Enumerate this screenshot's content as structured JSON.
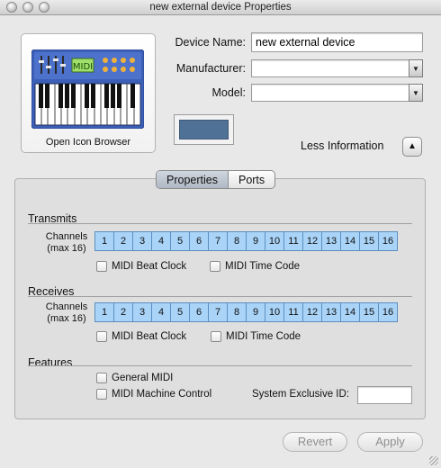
{
  "window": {
    "title": "new external device Properties"
  },
  "icon": {
    "caption": "Open Icon Browser",
    "display_text": "MIDI"
  },
  "form": {
    "device_name_label": "Device Name:",
    "device_name_value": "new external device",
    "manufacturer_label": "Manufacturer:",
    "manufacturer_value": "",
    "model_label": "Model:",
    "model_value": "",
    "color": "#4f7196"
  },
  "disclosure": {
    "label": "Less Information"
  },
  "tabs": [
    {
      "label": "Properties",
      "selected": true
    },
    {
      "label": "Ports",
      "selected": false
    }
  ],
  "transmits": {
    "title": "Transmits",
    "channels_label_line1": "Channels",
    "channels_label_line2": "(max 16)",
    "channels": [
      "1",
      "2",
      "3",
      "4",
      "5",
      "6",
      "7",
      "8",
      "9",
      "10",
      "11",
      "12",
      "13",
      "14",
      "15",
      "16"
    ],
    "beat_clock_label": "MIDI Beat Clock",
    "time_code_label": "MIDI Time Code"
  },
  "receives": {
    "title": "Receives",
    "channels_label_line1": "Channels",
    "channels_label_line2": "(max 16)",
    "channels": [
      "1",
      "2",
      "3",
      "4",
      "5",
      "6",
      "7",
      "8",
      "9",
      "10",
      "11",
      "12",
      "13",
      "14",
      "15",
      "16"
    ],
    "beat_clock_label": "MIDI Beat Clock",
    "time_code_label": "MIDI Time Code"
  },
  "features": {
    "title": "Features",
    "general_midi_label": "General MIDI",
    "machine_control_label": "MIDI Machine Control",
    "sysex_label": "System Exclusive ID:",
    "sysex_value": ""
  },
  "buttons": {
    "revert": "Revert",
    "apply": "Apply"
  },
  "colors": {
    "channel_selected": "#a9d3f7",
    "channel_border": "#5b8fc0",
    "device_color": "#4f7196"
  }
}
